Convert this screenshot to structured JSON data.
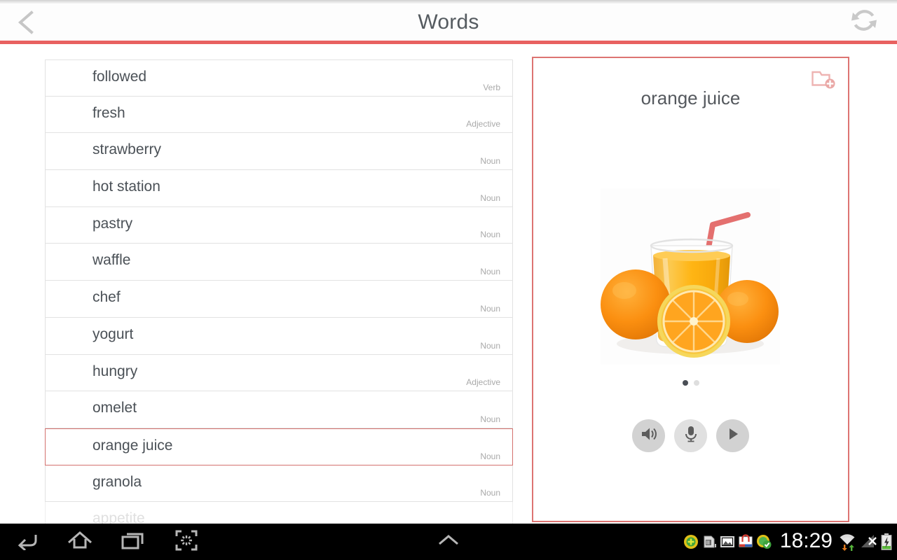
{
  "header": {
    "title": "Words",
    "back_icon": "chevron-left-icon",
    "refresh_icon": "refresh-icon",
    "accent_color": "#e86160"
  },
  "word_list": {
    "columns": [
      "word",
      "part_of_speech"
    ],
    "rows": [
      {
        "word": "followed",
        "pos": "Verb",
        "selected": false
      },
      {
        "word": "fresh",
        "pos": "Adjective",
        "selected": false
      },
      {
        "word": "strawberry",
        "pos": "Noun",
        "selected": false
      },
      {
        "word": "hot station",
        "pos": "Noun",
        "selected": false
      },
      {
        "word": "pastry",
        "pos": "Noun",
        "selected": false
      },
      {
        "word": "waffle",
        "pos": "Noun",
        "selected": false
      },
      {
        "word": "chef",
        "pos": "Noun",
        "selected": false
      },
      {
        "word": "yogurt",
        "pos": "Noun",
        "selected": false
      },
      {
        "word": "hungry",
        "pos": "Adjective",
        "selected": false
      },
      {
        "word": "omelet",
        "pos": "Noun",
        "selected": false
      },
      {
        "word": "orange juice",
        "pos": "Noun",
        "selected": true
      },
      {
        "word": "granola",
        "pos": "Noun",
        "selected": false
      },
      {
        "word": "appetite",
        "pos": "",
        "selected": false
      }
    ]
  },
  "detail": {
    "word": "orange juice",
    "add_icon": "folder-add-icon",
    "image_alt": "glass of orange juice with straw and three oranges",
    "border_color": "#dd7472",
    "pager": {
      "count": 2,
      "active_index": 0
    },
    "controls": [
      {
        "name": "speaker-button",
        "icon": "speaker-icon"
      },
      {
        "name": "microphone-button",
        "icon": "microphone-icon"
      },
      {
        "name": "play-button",
        "icon": "play-icon"
      }
    ]
  },
  "navbar": {
    "buttons": [
      {
        "name": "nav-back",
        "icon": "back-arrow-icon"
      },
      {
        "name": "nav-home",
        "icon": "home-icon"
      },
      {
        "name": "nav-recents",
        "icon": "recent-apps-icon"
      },
      {
        "name": "nav-screenshot",
        "icon": "screenshot-icon"
      }
    ],
    "up_icon": "chevron-up-icon",
    "clock": "18:29",
    "status_icons": [
      "green-plus-badge-icon",
      "sd-card-icon",
      "gallery-image-icon",
      "market-store-icon",
      "green-check-badge-icon",
      "wifi-icon",
      "signal-off-icon",
      "battery-charging-icon"
    ]
  }
}
